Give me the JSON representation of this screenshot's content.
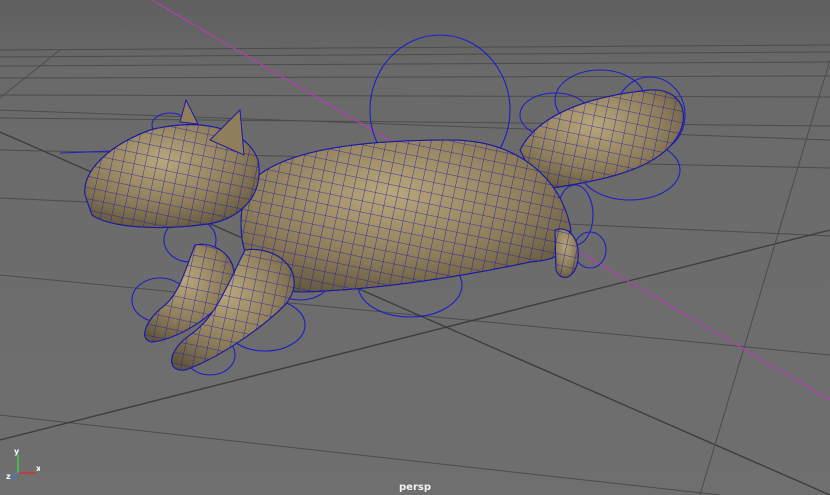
{
  "viewport": {
    "camera_label": "persp",
    "colors": {
      "background": "#6b6b6b",
      "grid": "#4a4a4a",
      "axis_line": "#b040b0",
      "mesh_fill": "#8f7e5b",
      "wireframe": "#1a1aa8",
      "controls": "#1e1ec8"
    }
  },
  "axis_gizmo": {
    "x_label": "x",
    "y_label": "y",
    "z_label": "z",
    "x_color": "#d33030",
    "y_color": "#40d040",
    "z_color": "#3a7ad8"
  },
  "scene": {
    "object_icon": "squirrel-mesh-icon"
  }
}
